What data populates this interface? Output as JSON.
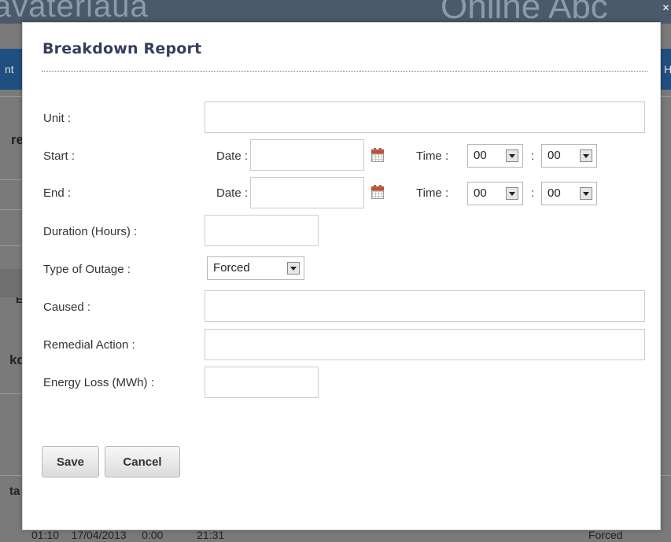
{
  "background": {
    "header_left_text": "avateriaua",
    "header_right_text": "Online Abc",
    "nav_left_text": "nt",
    "nav_right_text": "H",
    "edge_texts": [
      "re",
      "E",
      "kd",
      "ta"
    ],
    "bottom_row_text": "01:10    17/04/2013     0:00           21:31",
    "bottom_row_right": "Forced"
  },
  "modal": {
    "close_glyph": "✕",
    "title": "Breakdown Report",
    "form": {
      "unit": {
        "label": "Unit :",
        "value": ""
      },
      "start": {
        "label": "Start :",
        "date_label": "Date :",
        "date_value": "",
        "time_label": "Time :",
        "hour": "00",
        "separator": ":",
        "minute": "00"
      },
      "end": {
        "label": "End :",
        "date_label": "Date :",
        "date_value": "",
        "time_label": "Time :",
        "hour": "00",
        "separator": ":",
        "minute": "00"
      },
      "duration": {
        "label": "Duration (Hours) :",
        "value": ""
      },
      "outage_type": {
        "label": "Type of Outage :",
        "selected": "Forced"
      },
      "caused": {
        "label": "Caused :",
        "value": ""
      },
      "remedial_action": {
        "label": "Remedial Action :",
        "value": ""
      },
      "energy_loss": {
        "label": "Energy Loss (MWh) :",
        "value": ""
      }
    },
    "buttons": {
      "save": "Save",
      "cancel": "Cancel"
    }
  },
  "icons": {
    "calendar": "calendar-icon",
    "dropdown": "chevron-down-icon",
    "close": "close-icon"
  },
  "colors": {
    "title": "#34405a",
    "overlay": "#7a7a7a",
    "nav": "#1f4f80",
    "calendar_accent": "#d6462d"
  }
}
